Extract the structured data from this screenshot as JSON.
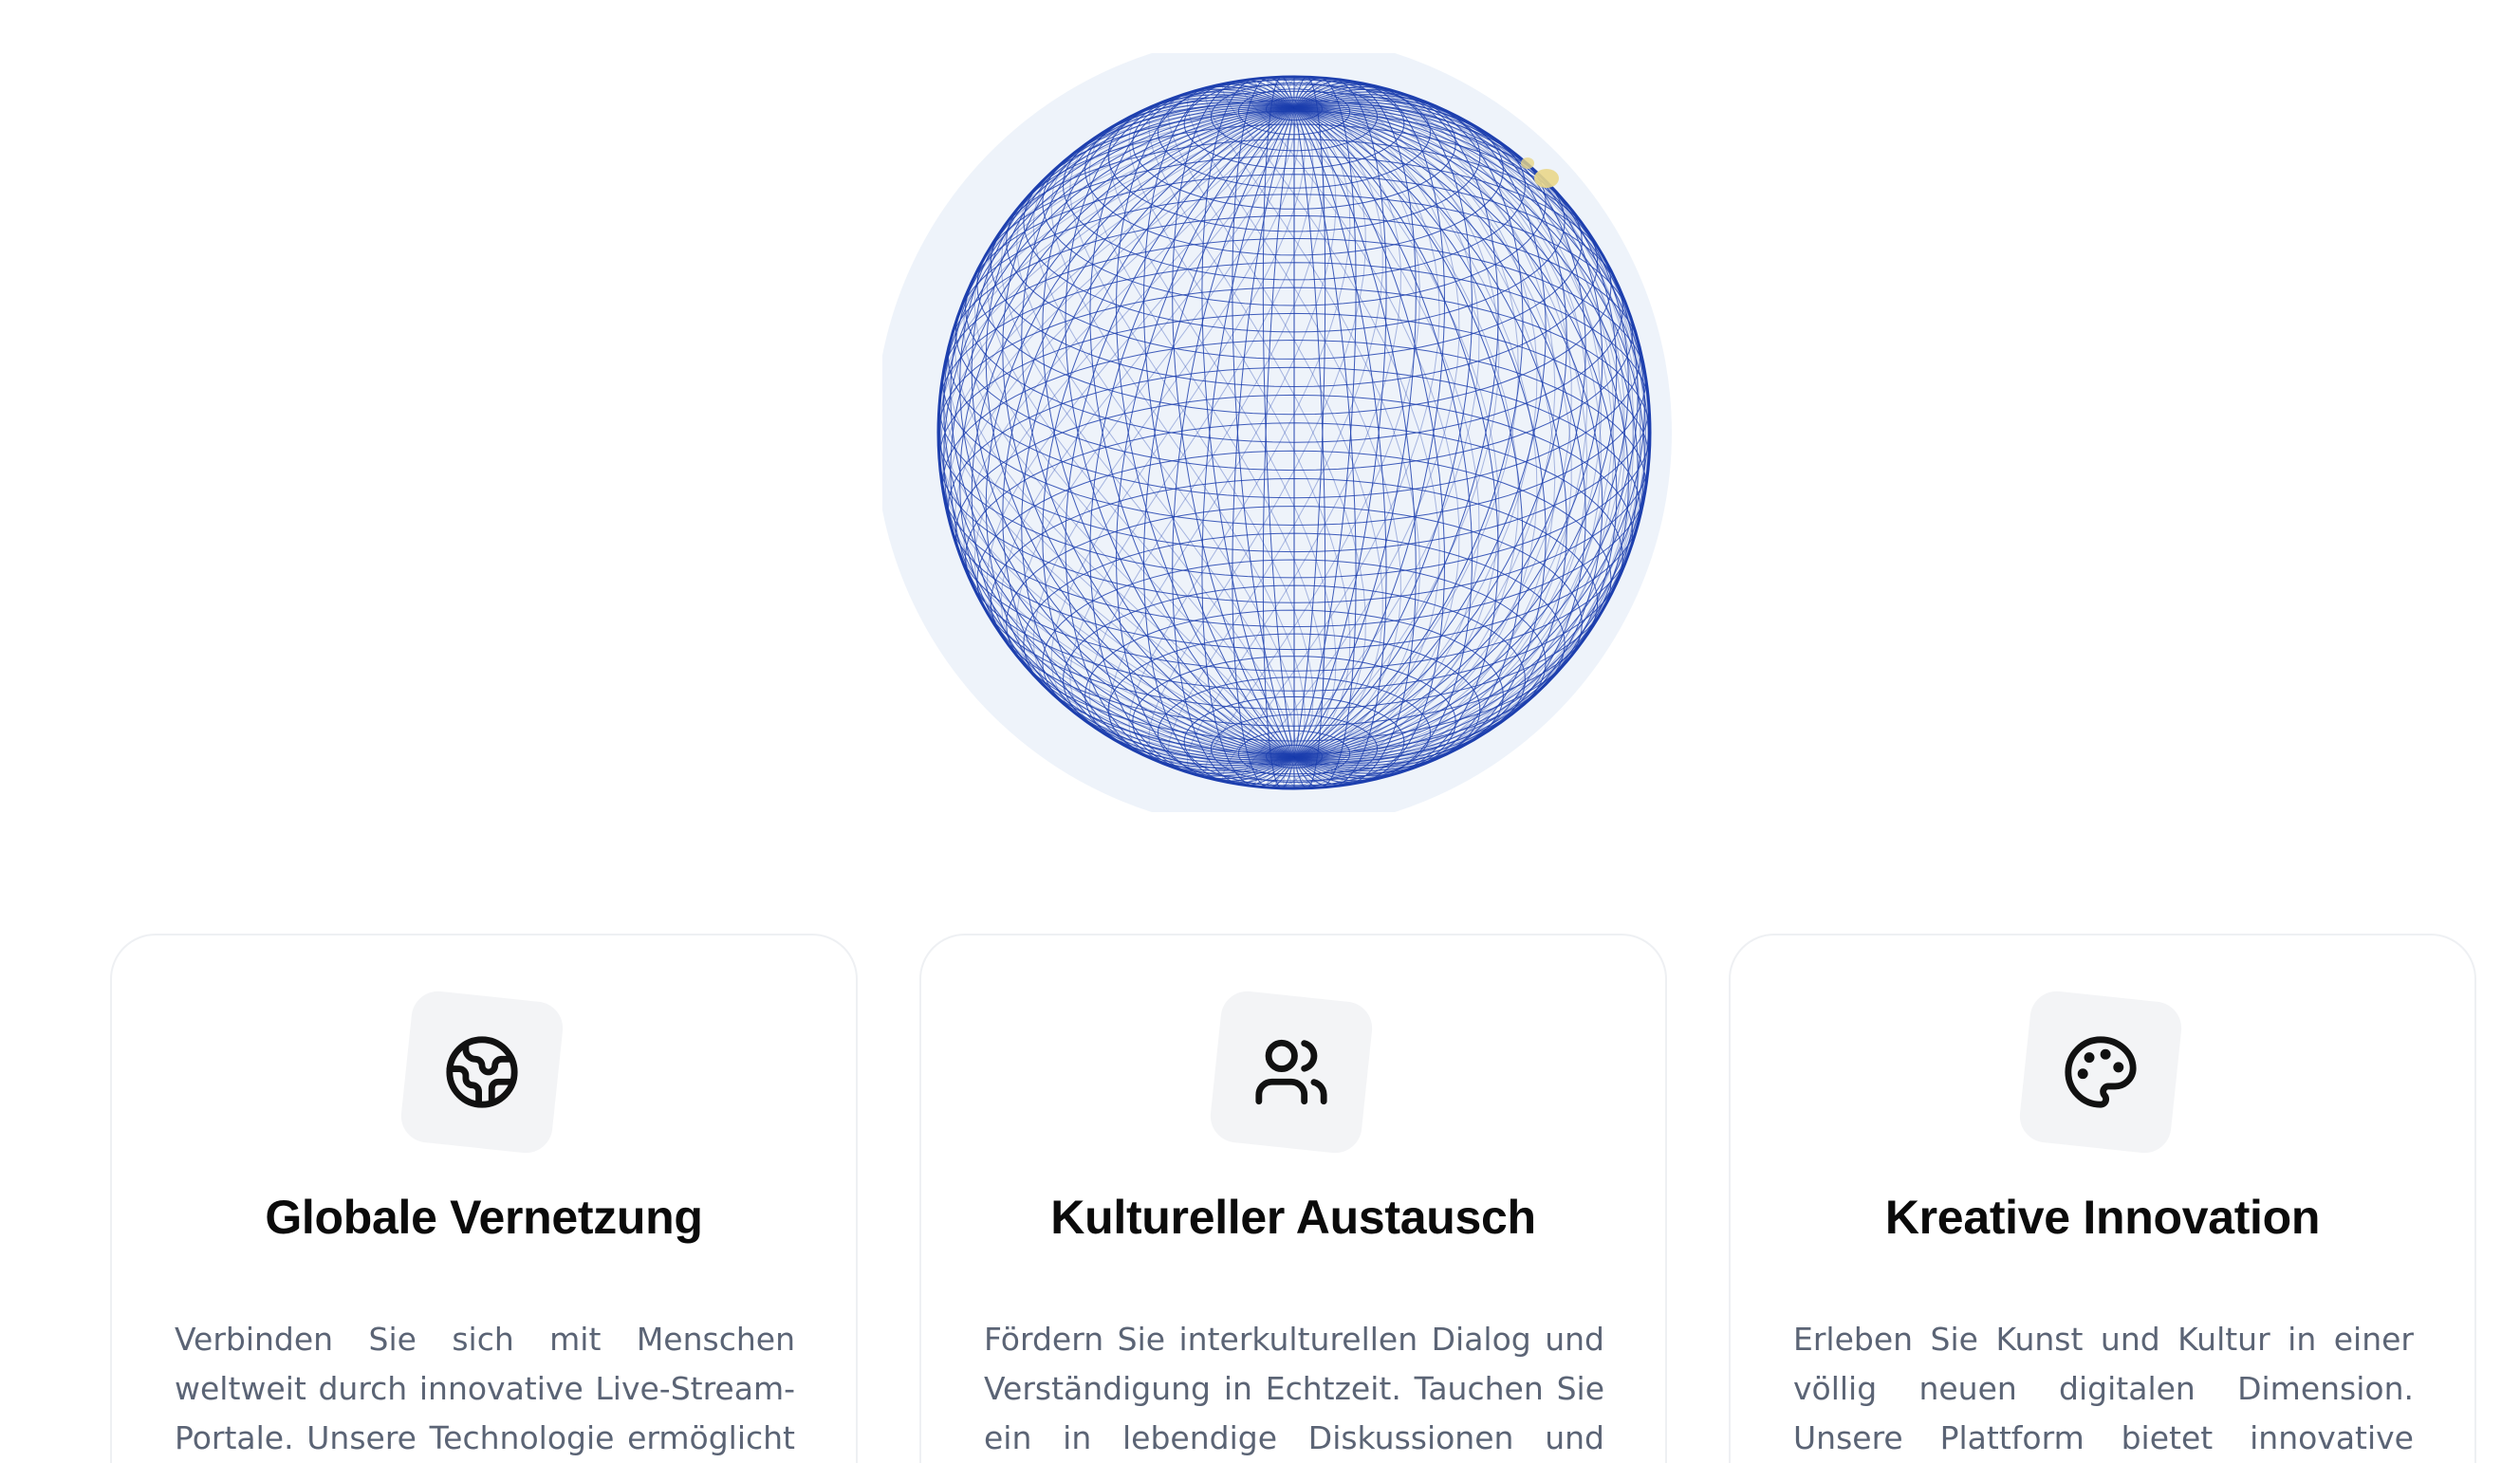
{
  "colors": {
    "globe_stroke": "#1d3fae",
    "globe_halo": "#eef3fa",
    "marker": "#e9d78a",
    "card_border": "#eef0f3",
    "icon_bg": "#f3f4f6",
    "title": "#0b0b0b",
    "body_text": "#5b6475"
  },
  "globe": {
    "icon": "wireframe-globe"
  },
  "features": [
    {
      "icon": "globe-icon",
      "title": "Globale Vernetzung",
      "text": "Verbinden Sie sich mit Menschen weltweit durch innovative Live-Stream-Portale. Unsere Technologie ermöglicht es Ihnen,"
    },
    {
      "icon": "users-icon",
      "title": "Kultureller Austausch",
      "text": "Fördern Sie interkulturellen Dialog und Verständigung in Echtzeit. Tauchen Sie ein in lebendige Diskussionen und entdecken"
    },
    {
      "icon": "palette-icon",
      "title": "Kreative Innovation",
      "text": "Erleben Sie Kunst und Kultur in einer völlig neuen digitalen Dimension. Unsere Plattform bietet innovative Werkzeuge und"
    }
  ]
}
